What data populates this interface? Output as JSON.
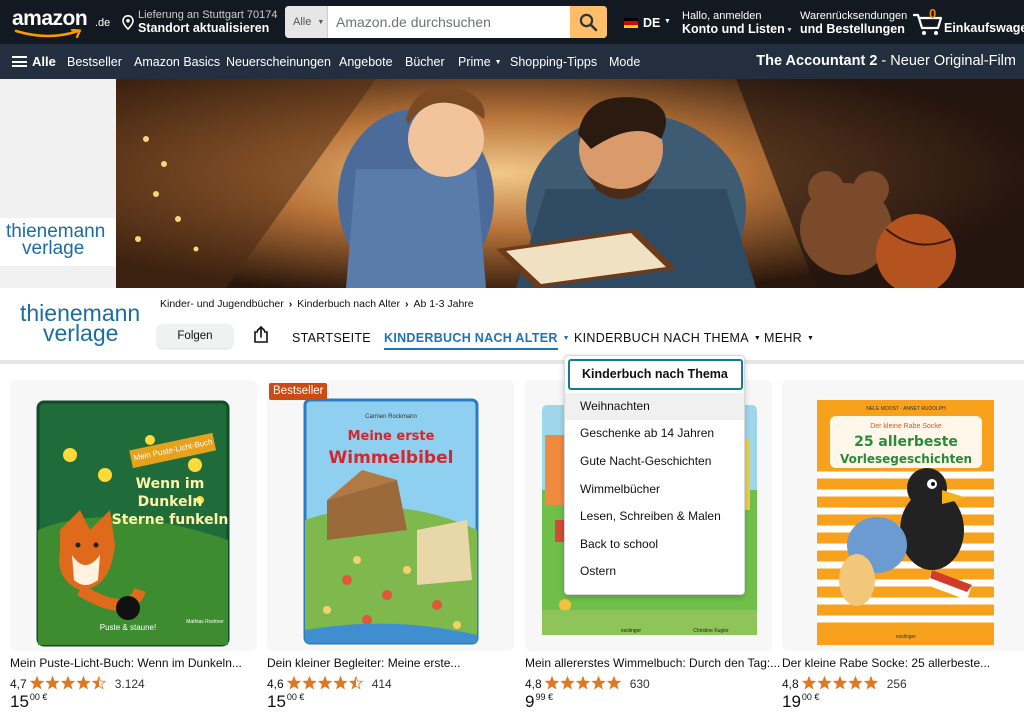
{
  "header": {
    "logo_text": "amazon",
    "logo_tld": ".de",
    "deliver_line1": "Lieferung an Stuttgart 70174",
    "deliver_line2": "Standort aktualisieren",
    "search_category": "Alle",
    "search_placeholder": "Amazon.de durchsuchen",
    "language": "DE",
    "account_line1": "Hallo, anmelden",
    "account_line2": "Konto und Listen",
    "returns_line1": "Warenrücksendungen",
    "returns_line2": "und Bestellungen",
    "cart_count": "0",
    "cart_label": "Einkaufswagen"
  },
  "subnav": {
    "all_label": "Alle",
    "items": [
      "Bestseller",
      "Amazon Basics",
      "Neuerscheinungen",
      "Angebote",
      "Bücher",
      "Prime",
      "Shopping-Tipps",
      "Mode"
    ],
    "promo_bold": "The Accountant 2",
    "promo_rest": " - Neuer Original-Film"
  },
  "brand": {
    "line1": "thienemann",
    "line2": "verlage"
  },
  "store": {
    "breadcrumbs": [
      "Kinder- und Jugendbücher",
      "Kinderbuch nach Alter",
      "Ab 1-3 Jahre"
    ],
    "follow_label": "Folgen",
    "nav": [
      "STARTSEITE",
      "KINDERBUCH NACH ALTER",
      "KINDERBUCH NACH THEMA",
      "MEHR"
    ],
    "active_nav_index": 1
  },
  "dropdown": {
    "heading": "Kinderbuch nach Thema",
    "options": [
      "Weihnachten",
      "Geschenke ab 14 Jahren",
      "Gute Nacht-Geschichten",
      "Wimmelbücher",
      "Lesen, Schreiben & Malen",
      "Back to school",
      "Ostern"
    ],
    "hovered_index": 0
  },
  "products": [
    {
      "title": "Mein Puste-Licht-Buch: Wenn im Dunkeln...",
      "rating": "4,7",
      "stars": 4.5,
      "reviews": "3.124",
      "price_main": "15",
      "price_cents": "00 €",
      "badge": "",
      "cover_title": "Wenn im Dunkeln Sterne funkeln",
      "cover_tag": "Mein Puste-Licht-Buch",
      "cover_bottom": "Puste & staune!",
      "cover_author": "Mathias Rockner"
    },
    {
      "title": "Dein kleiner Begleiter: Meine erste...",
      "rating": "4,6",
      "stars": 4.5,
      "reviews": "414",
      "price_main": "15",
      "price_cents": "00 €",
      "badge": "Bestseller",
      "cover_title": "Meine erste Wimmelbibel",
      "cover_author": "Carmen Rockmann"
    },
    {
      "title": "Mein allererstes Wimmelbuch: Durch den Tag:...",
      "rating": "4,8",
      "stars": 5,
      "reviews": "630",
      "price_main": "9",
      "price_cents": "99 €",
      "badge": "",
      "cover_author": "Christine Kugler",
      "cover_publisher": "esslinger"
    },
    {
      "title": "Der kleine Rabe Socke: 25 allerbeste...",
      "rating": "4,8",
      "stars": 5,
      "reviews": "256",
      "price_main": "19",
      "price_cents": "00 €",
      "badge": "",
      "cover_authors": "NELE MOOST · ANNET RUDOLPH",
      "cover_series": "Der kleine Rabe Socke",
      "cover_title": "25 allerbeste Vorlesegeschichten",
      "cover_publisher": "esslinger"
    }
  ],
  "colors": {
    "nav_dark": "#131921",
    "subnav": "#232f3e",
    "search_button": "#febd69",
    "link_blue": "#1f73b7",
    "badge": "#cc4b12",
    "star": "#de7921",
    "brand_blue": "#1a6da3"
  }
}
